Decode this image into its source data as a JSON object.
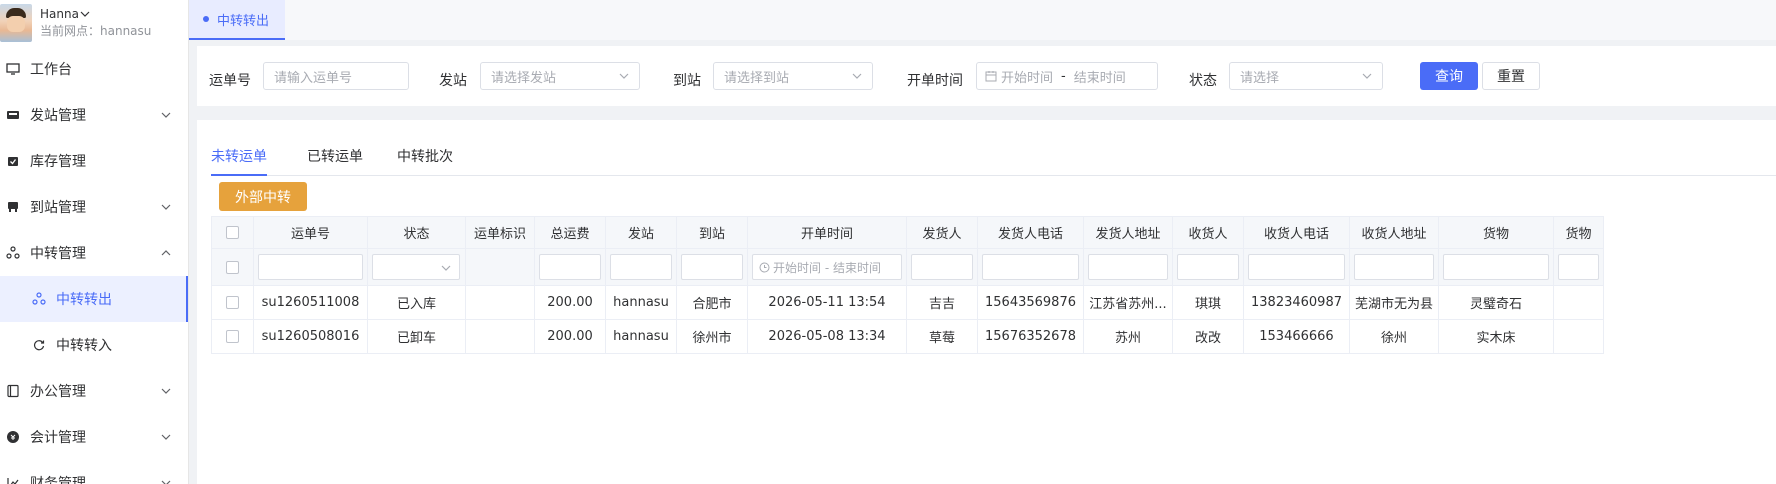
{
  "user": {
    "name": "Hanna",
    "site": "当前网点：hannasu"
  },
  "menu": [
    {
      "label": "工作台",
      "icon": "monitor-icon",
      "arrow": false
    },
    {
      "label": "发站管理",
      "icon": "truck-icon",
      "arrow": true
    },
    {
      "label": "库存管理",
      "icon": "box-icon",
      "arrow": false
    },
    {
      "label": "到站管理",
      "icon": "printer-icon",
      "arrow": true
    },
    {
      "label": "中转管理",
      "icon": "transfer-icon",
      "arrow": true
    }
  ],
  "submenu": [
    {
      "label": "中转转出",
      "icon": "transfer-icon",
      "active": true
    },
    {
      "label": "中转转入",
      "icon": "refresh-icon",
      "active": false
    }
  ],
  "menu2": [
    {
      "label": "办公管理",
      "icon": "book-icon"
    },
    {
      "label": "会计管理",
      "icon": "coin-icon"
    },
    {
      "label": "财务管理",
      "icon": "chart-icon"
    }
  ],
  "top_tab": {
    "label": "中转转出"
  },
  "filter": {
    "waybill_label": "运单号",
    "waybill_placeholder": "请输入运单号",
    "from_label": "发站",
    "from_placeholder": "请选择发站",
    "to_label": "到站",
    "to_placeholder": "请选择到站",
    "time_label": "开单时间",
    "time_start": "开始时间",
    "time_sep": "-",
    "time_end": "结束时间",
    "status_label": "状态",
    "status_placeholder": "请选择",
    "query_button": "查询",
    "reset_button": "重置"
  },
  "tabs": [
    "未转运单",
    "已转运单",
    "中转批次"
  ],
  "external_button": "外部中转",
  "table": {
    "headers": [
      "运单号",
      "状态",
      "运单标识",
      "总运费",
      "发站",
      "到站",
      "开单时间",
      "发货人",
      "发货人电话",
      "发货人地址",
      "收货人",
      "收货人电话",
      "收货人地址",
      "货物",
      "货物"
    ],
    "filter_time": "开始时间 - 结束时间",
    "rows": [
      {
        "waybill": "su1260511008",
        "status": "已入库",
        "mark": "",
        "fee": "200.00",
        "from": "hannasu",
        "to": "合肥市",
        "time": "2026-05-11 13:54",
        "shipper": "吉吉",
        "shipper_phone": "15643569876",
        "shipper_addr": "江苏省苏州...",
        "receiver": "琪琪",
        "receiver_phone": "13823460987",
        "receiver_addr": "芜湖市无为县",
        "goods": "灵璧奇石",
        "goods2": ""
      },
      {
        "waybill": "su1260508016",
        "status": "已卸车",
        "mark": "",
        "fee": "200.00",
        "from": "hannasu",
        "to": "徐州市",
        "time": "2026-05-08 13:34",
        "shipper": "草莓",
        "shipper_phone": "15676352678",
        "shipper_addr": "苏州",
        "receiver": "改改",
        "receiver_phone": "153466666",
        "receiver_addr": "徐州",
        "goods": "实木床",
        "goods2": ""
      }
    ]
  }
}
